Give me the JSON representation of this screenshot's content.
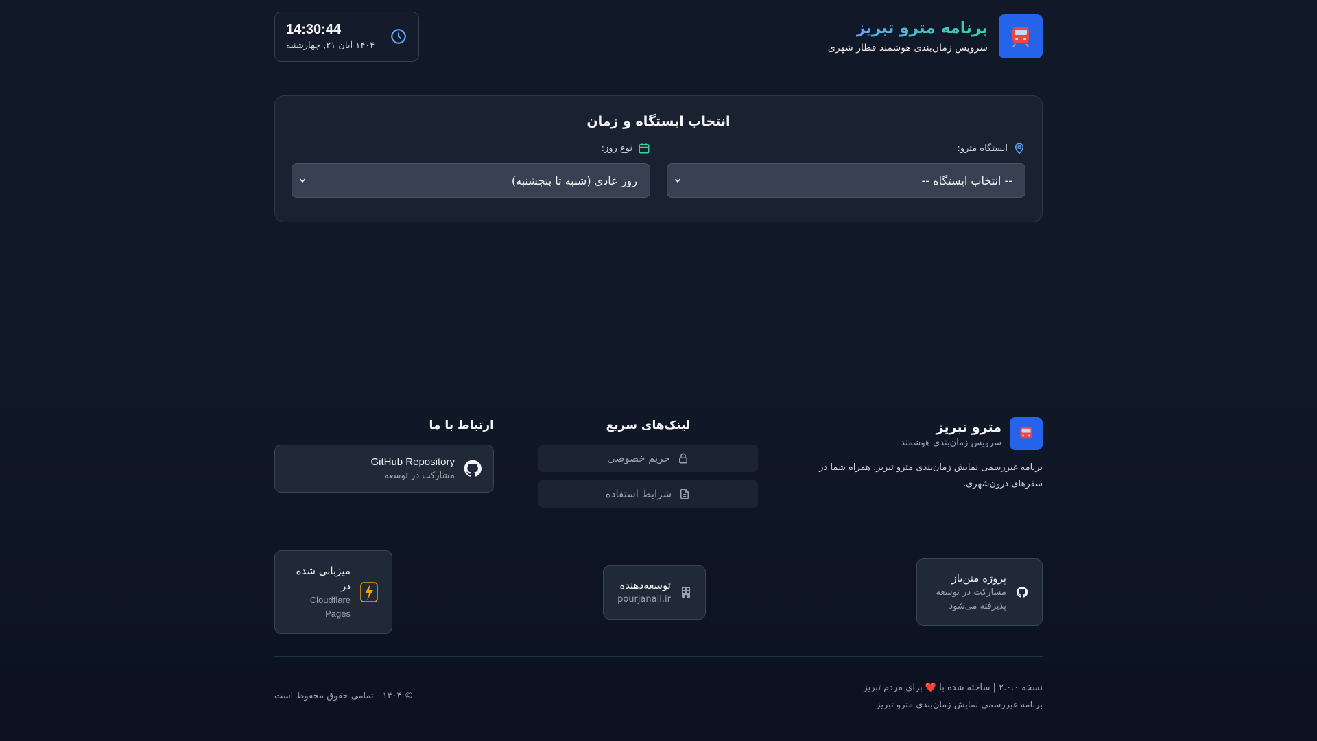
{
  "header": {
    "title": "برنامه مترو تبریز",
    "subtitle": "سرویس زمان‌بندی هوشمند قطار شهری",
    "logo_icon": "train-icon",
    "clock": {
      "time": "14:30:44",
      "date": "۱۴۰۴ آبان ۲۱, چهارشنبه",
      "icon": "clock-icon"
    }
  },
  "selector": {
    "title": "انتخاب ایستگاه و زمان",
    "station": {
      "label": "ایستگاه مترو:",
      "icon": "map-pin-icon",
      "value": "-- انتخاب ایستگاه --"
    },
    "day_type": {
      "label": "نوع روز:",
      "icon": "calendar-icon",
      "value": "روز عادی (شنبه تا پنجشنبه)"
    }
  },
  "footer": {
    "brand": {
      "title": "مترو تبریز",
      "subtitle": "سرویس زمان‌بندی هوشمند",
      "description": "برنامه غیررسمی نمایش زمان‌بندی مترو تبریز. همراه شما در سفرهای درون‌شهری."
    },
    "quick_links": {
      "title": "لینک‌های سریع",
      "items": [
        {
          "label": "حریم خصوصی",
          "icon": "lock-icon"
        },
        {
          "label": "شرایط استفاده",
          "icon": "document-icon"
        }
      ]
    },
    "contact": {
      "title": "ارتباط با ما",
      "github_title": "GitHub Repository",
      "github_sub": "مشارکت در توسعه"
    },
    "badges": {
      "open_source": {
        "title": "پروژه متن‌باز",
        "sub": "مشارکت در توسعه پذیرفته می‌شود"
      },
      "developer": {
        "title": "توسعه‌دهنده",
        "sub": "pourjanali.ir"
      },
      "hosting": {
        "title": "میزبانی شده در",
        "sub": "Cloudflare Pages"
      }
    },
    "bottom": {
      "version_prefix": "نسخه ۲.۰.۰ | ساخته شده با",
      "version_suffix": "برای مردم تبریز",
      "note": "برنامه غیررسمی نمایش زمان‌بندی مترو تبریز",
      "copyright": "© ۱۴۰۴ - تمامی حقوق محفوظ است"
    }
  },
  "colors": {
    "background": "#111827",
    "accent": "#2563eb",
    "title_gradient_start": "#60a5fa",
    "title_gradient_end": "#34d399"
  }
}
